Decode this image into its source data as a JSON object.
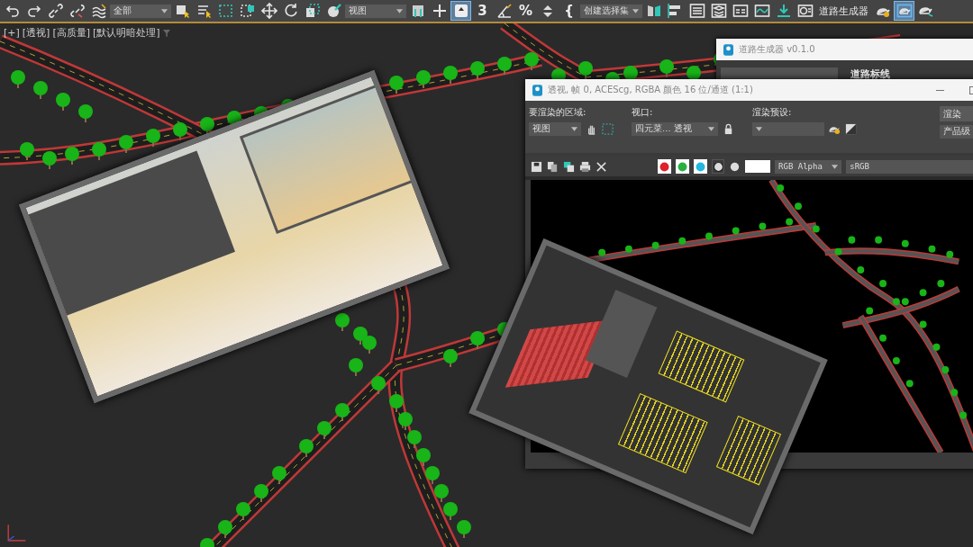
{
  "toolbar": {
    "items": [
      {
        "kind": "undo",
        "selected": false
      },
      {
        "kind": "redo",
        "selected": false
      },
      {
        "kind": "link",
        "selected": false
      },
      {
        "kind": "unlink",
        "selected": false
      },
      {
        "kind": "warp",
        "selected": false
      },
      {
        "kind": "dropdown",
        "value": "全部"
      },
      {
        "kind": "select",
        "selected": false
      },
      {
        "kind": "select-list",
        "selected": false
      },
      {
        "kind": "rect-select",
        "selected": false
      },
      {
        "kind": "window-select",
        "selected": false
      },
      {
        "kind": "move",
        "selected": false
      },
      {
        "kind": "rotate",
        "selected": false
      },
      {
        "kind": "scale",
        "selected": false
      },
      {
        "kind": "place",
        "selected": false
      },
      {
        "kind": "dropdown",
        "value": "视图"
      },
      {
        "kind": "pivot",
        "selected": false
      },
      {
        "kind": "crosshair",
        "selected": false
      },
      {
        "kind": "manipulate",
        "selected": true
      },
      {
        "kind": "glyph",
        "text": "3",
        "selected": false
      },
      {
        "kind": "angle",
        "selected": false
      },
      {
        "kind": "glyph",
        "text": "%",
        "selected": false
      },
      {
        "kind": "spinner",
        "selected": false
      },
      {
        "kind": "glyph",
        "text": "{",
        "selected": false
      },
      {
        "kind": "dropdown",
        "value": "创建选择集"
      },
      {
        "kind": "mirror",
        "selected": false
      },
      {
        "kind": "align",
        "selected": false
      },
      {
        "kind": "list",
        "selected": false
      },
      {
        "kind": "layers",
        "selected": false
      },
      {
        "kind": "panel",
        "selected": false
      },
      {
        "kind": "curve",
        "selected": false
      },
      {
        "kind": "download",
        "selected": false
      },
      {
        "kind": "material",
        "selected": false
      },
      {
        "kind": "text",
        "text": "道路生成器"
      },
      {
        "kind": "teapot-gear",
        "selected": false
      },
      {
        "kind": "teapot-frame",
        "selected": true
      },
      {
        "kind": "teapot-arrow",
        "selected": false
      }
    ]
  },
  "viewport": {
    "labels": [
      "[+]",
      "[透视]",
      "[高质量]",
      "[默认明暗处理]"
    ]
  },
  "road_generator_window": {
    "title": "道路生成器 v0.1.0",
    "section": "道路标线"
  },
  "render_window": {
    "title": "透视, 帧 0, ACEScg, RGBA 颜色 16 位/通道 (1:1)",
    "area_label": "要渲染的区域:",
    "area_value": "视图",
    "viewport_label": "视口:",
    "viewport_value": "四元菜… 透视",
    "preset_label": "渲染预设:",
    "render_button": "渲染",
    "quality_value": "产品级",
    "channels": [
      {
        "kind": "red",
        "selected": true
      },
      {
        "kind": "green",
        "selected": true
      },
      {
        "kind": "blue",
        "selected": true
      },
      {
        "kind": "mono",
        "selected": false
      }
    ],
    "display_value": "RGB Alpha",
    "color_space": "sRGB"
  }
}
